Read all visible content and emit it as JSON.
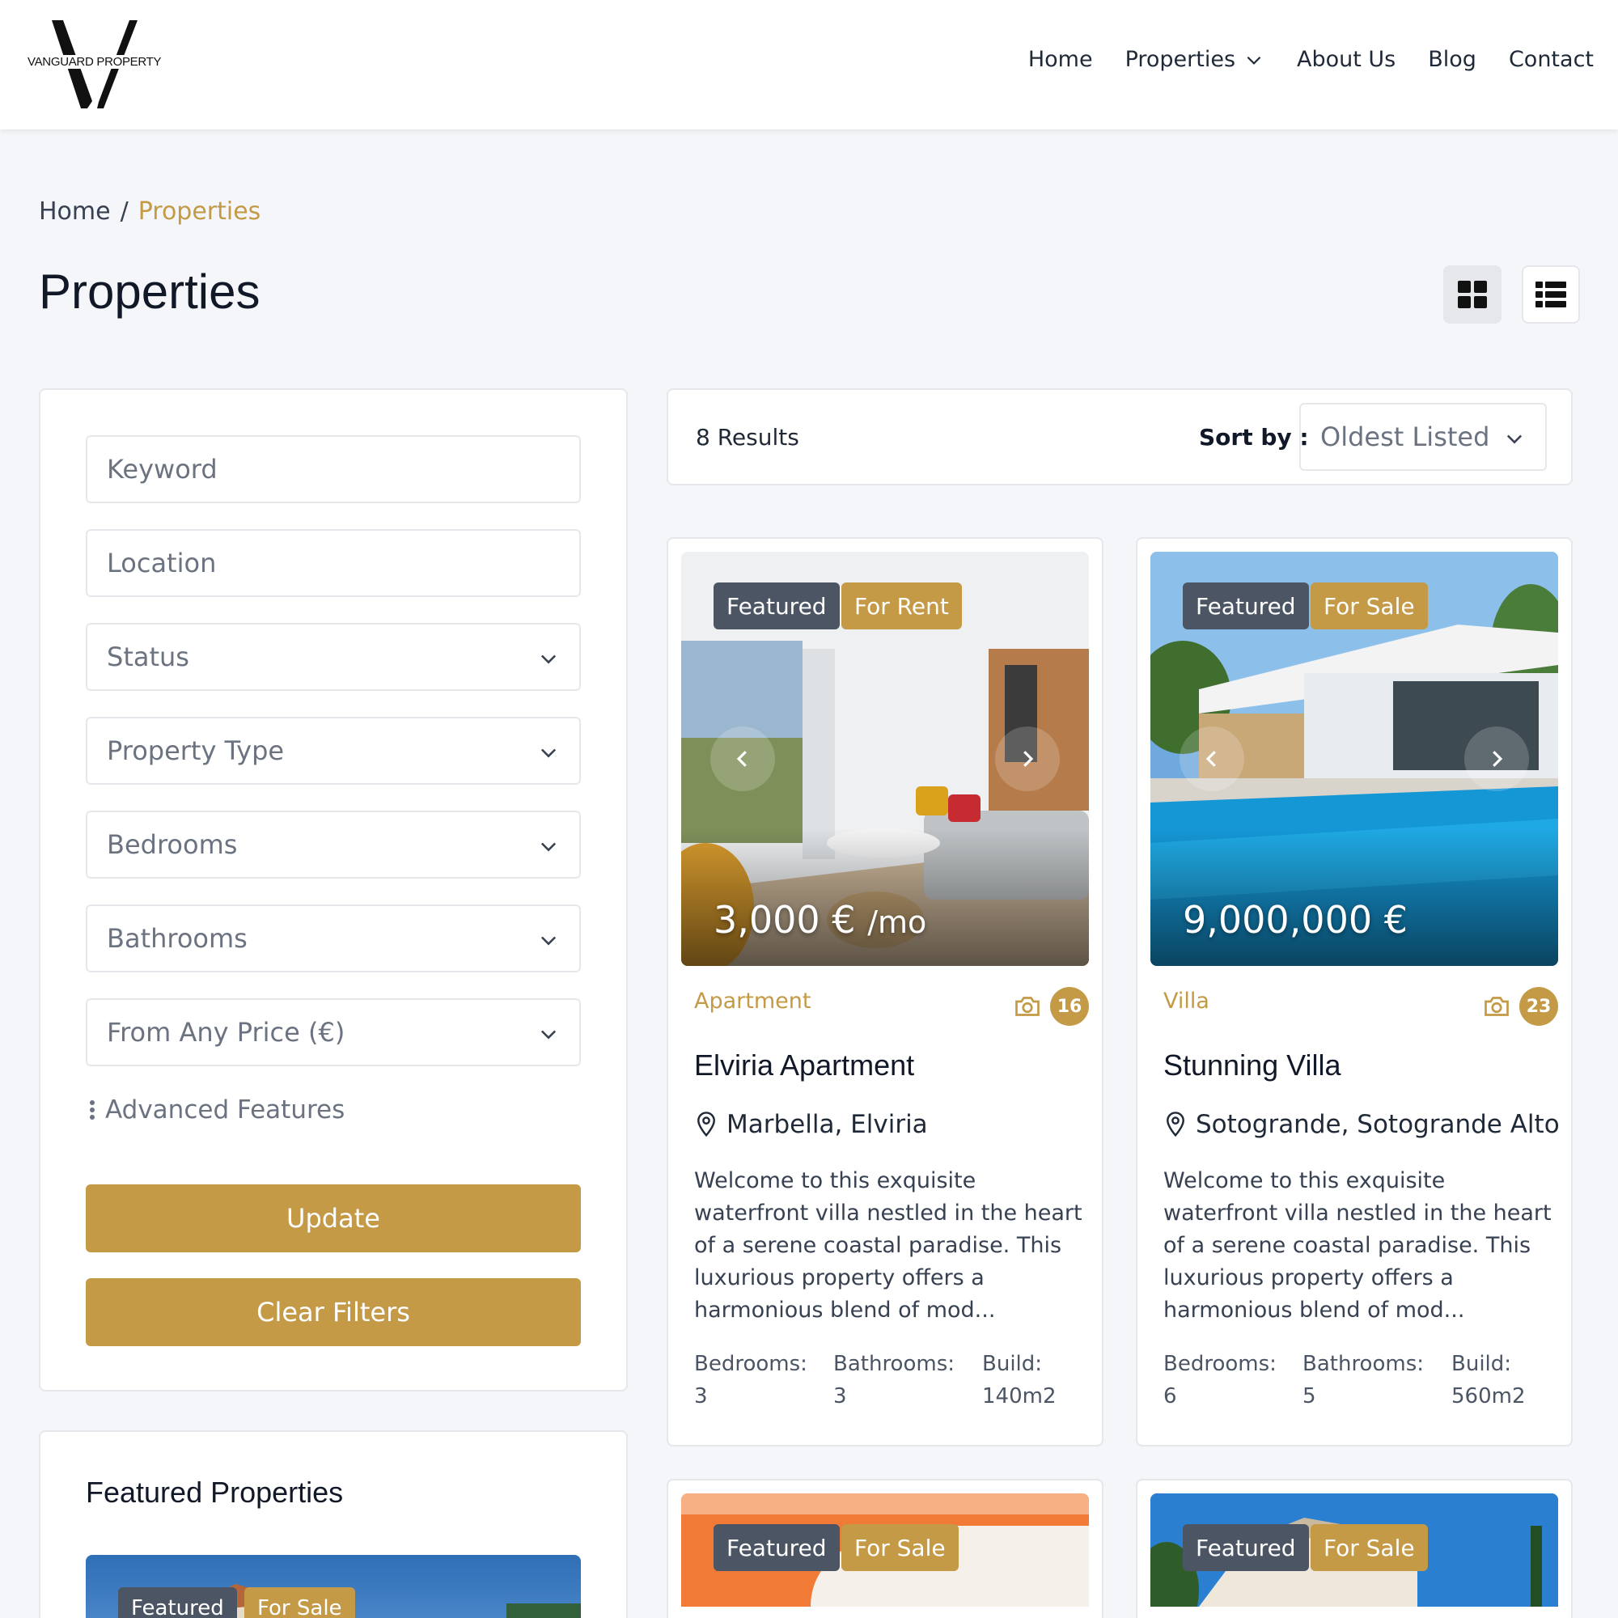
{
  "brand": {
    "name": "VANGUARD PROPERTY",
    "accent": "#c49a47"
  },
  "nav": {
    "home": "Home",
    "properties": "Properties",
    "about": "About Us",
    "blog": "Blog",
    "contact": "Contact"
  },
  "breadcrumb": {
    "home": "Home",
    "separator": "/",
    "current": "Properties"
  },
  "page_title": "Properties",
  "filters": {
    "keyword_placeholder": "Keyword",
    "location_placeholder": "Location",
    "status": "Status",
    "property_type": "Property Type",
    "bedrooms": "Bedrooms",
    "bathrooms": "Bathrooms",
    "price": "From Any Price (€)",
    "advanced": "Advanced Features",
    "update_label": "Update",
    "clear_label": "Clear Filters"
  },
  "featured": {
    "title": "Featured Properties",
    "badge_featured": "Featured",
    "badge_status": "For Sale"
  },
  "results": {
    "count": "8 Results",
    "sort_label": "Sort by :",
    "sort_value": "Oldest Listed"
  },
  "spec_labels": {
    "bedrooms": "Bedrooms:",
    "bathrooms": "Bathrooms:",
    "build": "Build:"
  },
  "cards": [
    {
      "badge_featured": "Featured",
      "badge_status": "For Rent",
      "price": "3,000 €",
      "price_suffix": "/mo",
      "type": "Apartment",
      "photos": "16",
      "title": "Elviria Apartment",
      "location": "Marbella, Elviria",
      "description": "Welcome to this exquisite waterfront villa nestled in the heart of a serene coastal paradise. This luxurious property offers a harmonious blend of mod...",
      "bedrooms": "3",
      "bathrooms": "3",
      "build": "140m2"
    },
    {
      "badge_featured": "Featured",
      "badge_status": "For Sale",
      "price": "9,000,000 €",
      "price_suffix": "",
      "type": "Villa",
      "photos": "23",
      "title": "Stunning Villa",
      "location": "Sotogrande, Sotogrande Alto",
      "description": "Welcome to this exquisite waterfront villa nestled in the heart of a serene coastal paradise. This luxurious property offers a harmonious blend of mod...",
      "bedrooms": "6",
      "bathrooms": "5",
      "build": "560m2"
    },
    {
      "badge_featured": "Featured",
      "badge_status": "For Sale"
    },
    {
      "badge_featured": "Featured",
      "badge_status": "For Sale"
    }
  ]
}
